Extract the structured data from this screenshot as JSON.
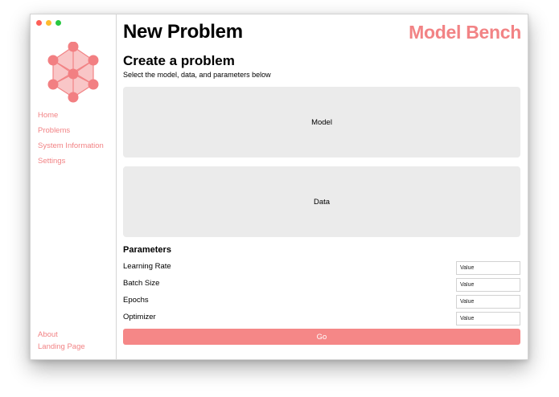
{
  "window": {
    "traffic_lights": {
      "close": "#fe5f57",
      "minimize": "#febc2e",
      "zoom": "#28c840"
    }
  },
  "sidebar": {
    "logo_icon": "neural-network-logo-icon",
    "nav": [
      {
        "label": "Home"
      },
      {
        "label": "Problems"
      },
      {
        "label": "System Information"
      },
      {
        "label": "Settings"
      }
    ],
    "bottom": [
      {
        "label": "About"
      },
      {
        "label": "Landing Page"
      }
    ]
  },
  "header": {
    "title": "New Problem",
    "brand": "Model Bench"
  },
  "form": {
    "title": "Create a problem",
    "subtitle": "Select the model, data, and parameters below",
    "model_label": "Model",
    "data_label": "Data",
    "parameters_title": "Parameters",
    "parameters": [
      {
        "label": "Learning Rate",
        "placeholder": "Value"
      },
      {
        "label": "Batch Size",
        "placeholder": "Value"
      },
      {
        "label": "Epochs",
        "placeholder": "Value"
      },
      {
        "label": "Optimizer",
        "placeholder": "Value"
      }
    ],
    "go_label": "Go"
  },
  "colors": {
    "accent": "#f28385",
    "button": "#f58787",
    "panel": "#ebebeb"
  }
}
